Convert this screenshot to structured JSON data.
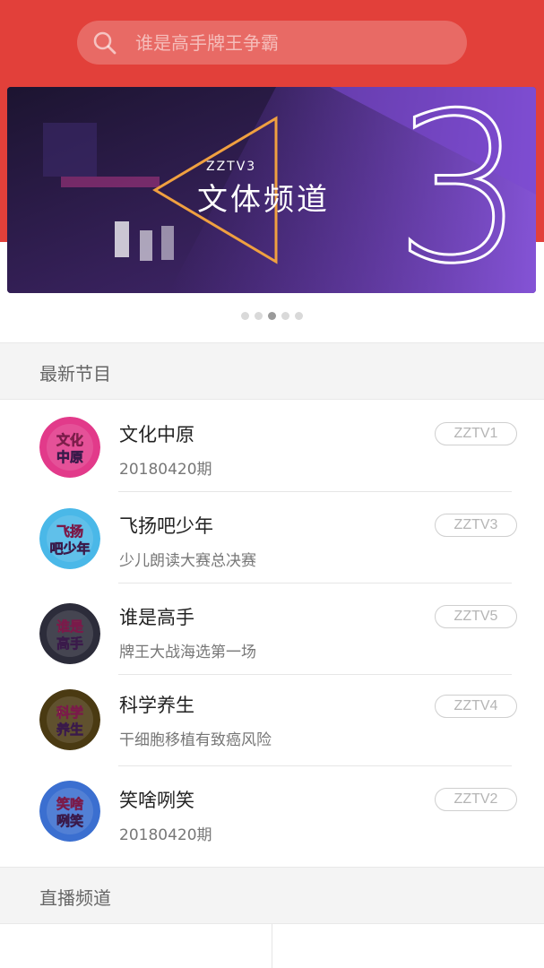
{
  "search": {
    "placeholder": "谁是高手牌王争霸",
    "icon": "search-icon"
  },
  "banner": {
    "subtitle": "ZZTV3",
    "title": "文体频道",
    "number": "3",
    "total_slides": 5,
    "active_slide": 3
  },
  "latest": {
    "header": "最新节目",
    "items": [
      {
        "title": "文化中原",
        "subtitle": "20180420期",
        "channel": "ZZTV1",
        "thumb_text": "文化中原",
        "thumb_color": "#e23a8a"
      },
      {
        "title": "飞扬吧少年",
        "subtitle": "少儿朗读大赛总决赛",
        "channel": "ZZTV3",
        "thumb_text": "飞扬吧少年",
        "thumb_color": "#4ab8e8"
      },
      {
        "title": "谁是高手",
        "subtitle": "牌王大战海选第一场",
        "channel": "ZZTV5",
        "thumb_text": "谁是高手",
        "thumb_color": "#2c2c3a"
      },
      {
        "title": "科学养生",
        "subtitle": "干细胞移植有致癌风险",
        "channel": "ZZTV4",
        "thumb_text": "科学养生",
        "thumb_color": "#4a3a12"
      },
      {
        "title": "笑啥咧笑",
        "subtitle": "20180420期",
        "channel": "ZZTV2",
        "thumb_text": "笑啥咧笑",
        "thumb_color": "#3b6fd0"
      }
    ]
  },
  "live": {
    "header": "直播频道"
  },
  "colors": {
    "brand": "#e2403a",
    "section_bg": "#f4f4f4",
    "badge_text": "#b5b5b5"
  }
}
